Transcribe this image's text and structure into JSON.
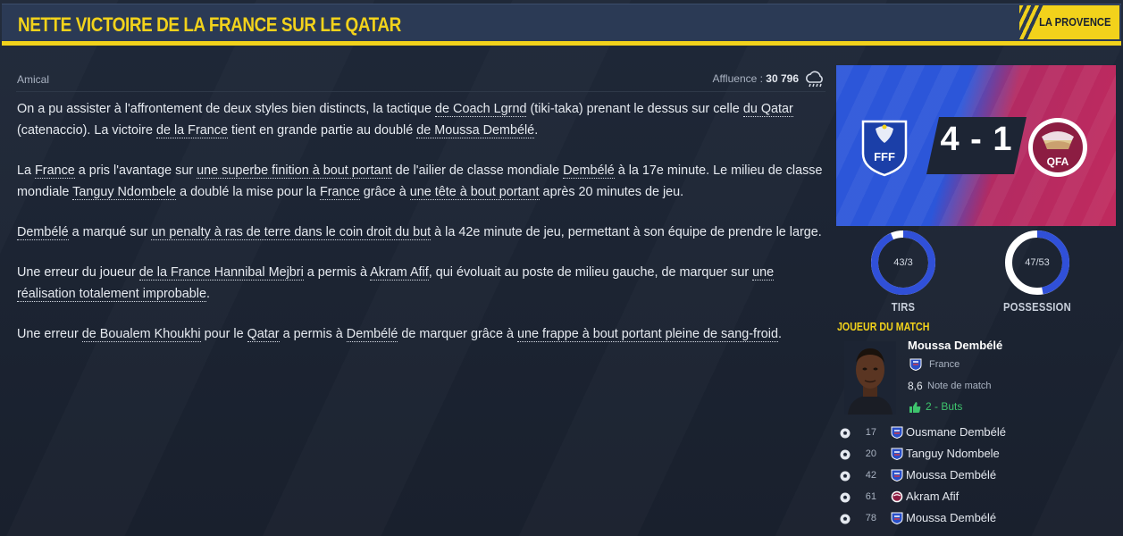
{
  "header": {
    "title": "NETTE VICTOIRE DE LA FRANCE SUR LE QATAR",
    "paper": "LA PROVENCE"
  },
  "meta": {
    "competition": "Amical",
    "attendance_label": "Affluence :",
    "attendance_value": "30 796",
    "weather_icon": "cloud-rain-icon"
  },
  "article": {
    "p1": [
      {
        "t": "On a pu assister à l'affrontement de deux styles bien distincts, la tactique "
      },
      {
        "t": "de Coach Lgrnd",
        "u": true
      },
      {
        "t": " (tiki-taka) prenant le dessus sur celle "
      },
      {
        "t": "du Qatar",
        "u": true
      },
      {
        "t": " (catenaccio). La victoire "
      },
      {
        "t": "de la France",
        "u": true
      },
      {
        "t": " tient en grande partie au doublé "
      },
      {
        "t": "de Moussa Dembélé",
        "u": true
      },
      {
        "t": "."
      }
    ],
    "p2": [
      {
        "t": "La "
      },
      {
        "t": "France",
        "u": true
      },
      {
        "t": " a pris l'avantage sur "
      },
      {
        "t": "une superbe finition à bout portant",
        "u": true
      },
      {
        "t": " de l'ailier de classe mondiale "
      },
      {
        "t": "Dembélé",
        "u": true
      },
      {
        "t": " à la 17e minute. Le milieu de classe mondiale "
      },
      {
        "t": "Tanguy Ndombele",
        "u": true
      },
      {
        "t": " a doublé la mise pour la "
      },
      {
        "t": "France",
        "u": true
      },
      {
        "t": " grâce à "
      },
      {
        "t": "une tête à bout portant",
        "u": true
      },
      {
        "t": " après 20 minutes de jeu."
      }
    ],
    "p3": [
      {
        "t": "Dembélé",
        "u": true
      },
      {
        "t": " a marqué sur "
      },
      {
        "t": "un penalty à ras de terre dans le coin droit du but",
        "u": true
      },
      {
        "t": " à la 42e minute de jeu, permettant à son équipe de prendre le large."
      }
    ],
    "p4": [
      {
        "t": "Une erreur du joueur "
      },
      {
        "t": "de la France Hannibal Mejbri",
        "u": true
      },
      {
        "t": " a permis à "
      },
      {
        "t": "Akram Afif",
        "u": true
      },
      {
        "t": ", qui évoluait au poste de milieu gauche, de marquer sur "
      },
      {
        "t": "une réalisation totalement improbable",
        "u": true
      },
      {
        "t": "."
      }
    ],
    "p5": [
      {
        "t": "Une erreur "
      },
      {
        "t": "de Boualem Khoukhi",
        "u": true
      },
      {
        "t": " pour le "
      },
      {
        "t": "Qatar",
        "u": true
      },
      {
        "t": " a permis à "
      },
      {
        "t": "Dembélé",
        "u": true
      },
      {
        "t": " de marquer grâce à "
      },
      {
        "t": "une frappe à bout portant pleine de sang-froid",
        "u": true
      },
      {
        "t": "."
      }
    ]
  },
  "match": {
    "score": "4 - 1",
    "home_badge": "fff-badge-icon",
    "home_badge_text": "FFF",
    "away_badge": "qfa-badge-icon",
    "away_badge_text": "QFA",
    "home_color": "#2c56d9",
    "away_color": "#c02a5e"
  },
  "stats": {
    "shots": {
      "value": "43/3",
      "label": "TIRS",
      "home_fraction": 0.935
    },
    "possession": {
      "value": "47/53",
      "label": "POSSESSION",
      "home_fraction": 0.47
    }
  },
  "motm": {
    "title": "JOUEUR DU MATCH",
    "name": "Moussa Dembélé",
    "country": "France",
    "rating": "8,6",
    "rating_label": "Note de match",
    "goals": "2 - Buts"
  },
  "goals": [
    {
      "minute": "17",
      "name": "Ousmane Dembélé",
      "team": "france"
    },
    {
      "minute": "20",
      "name": "Tanguy Ndombele",
      "team": "france"
    },
    {
      "minute": "42",
      "name": "Moussa Dembélé",
      "team": "france"
    },
    {
      "minute": "61",
      "name": "Akram Afif",
      "team": "qatar"
    },
    {
      "minute": "78",
      "name": "Moussa Dembélé",
      "team": "france"
    }
  ]
}
